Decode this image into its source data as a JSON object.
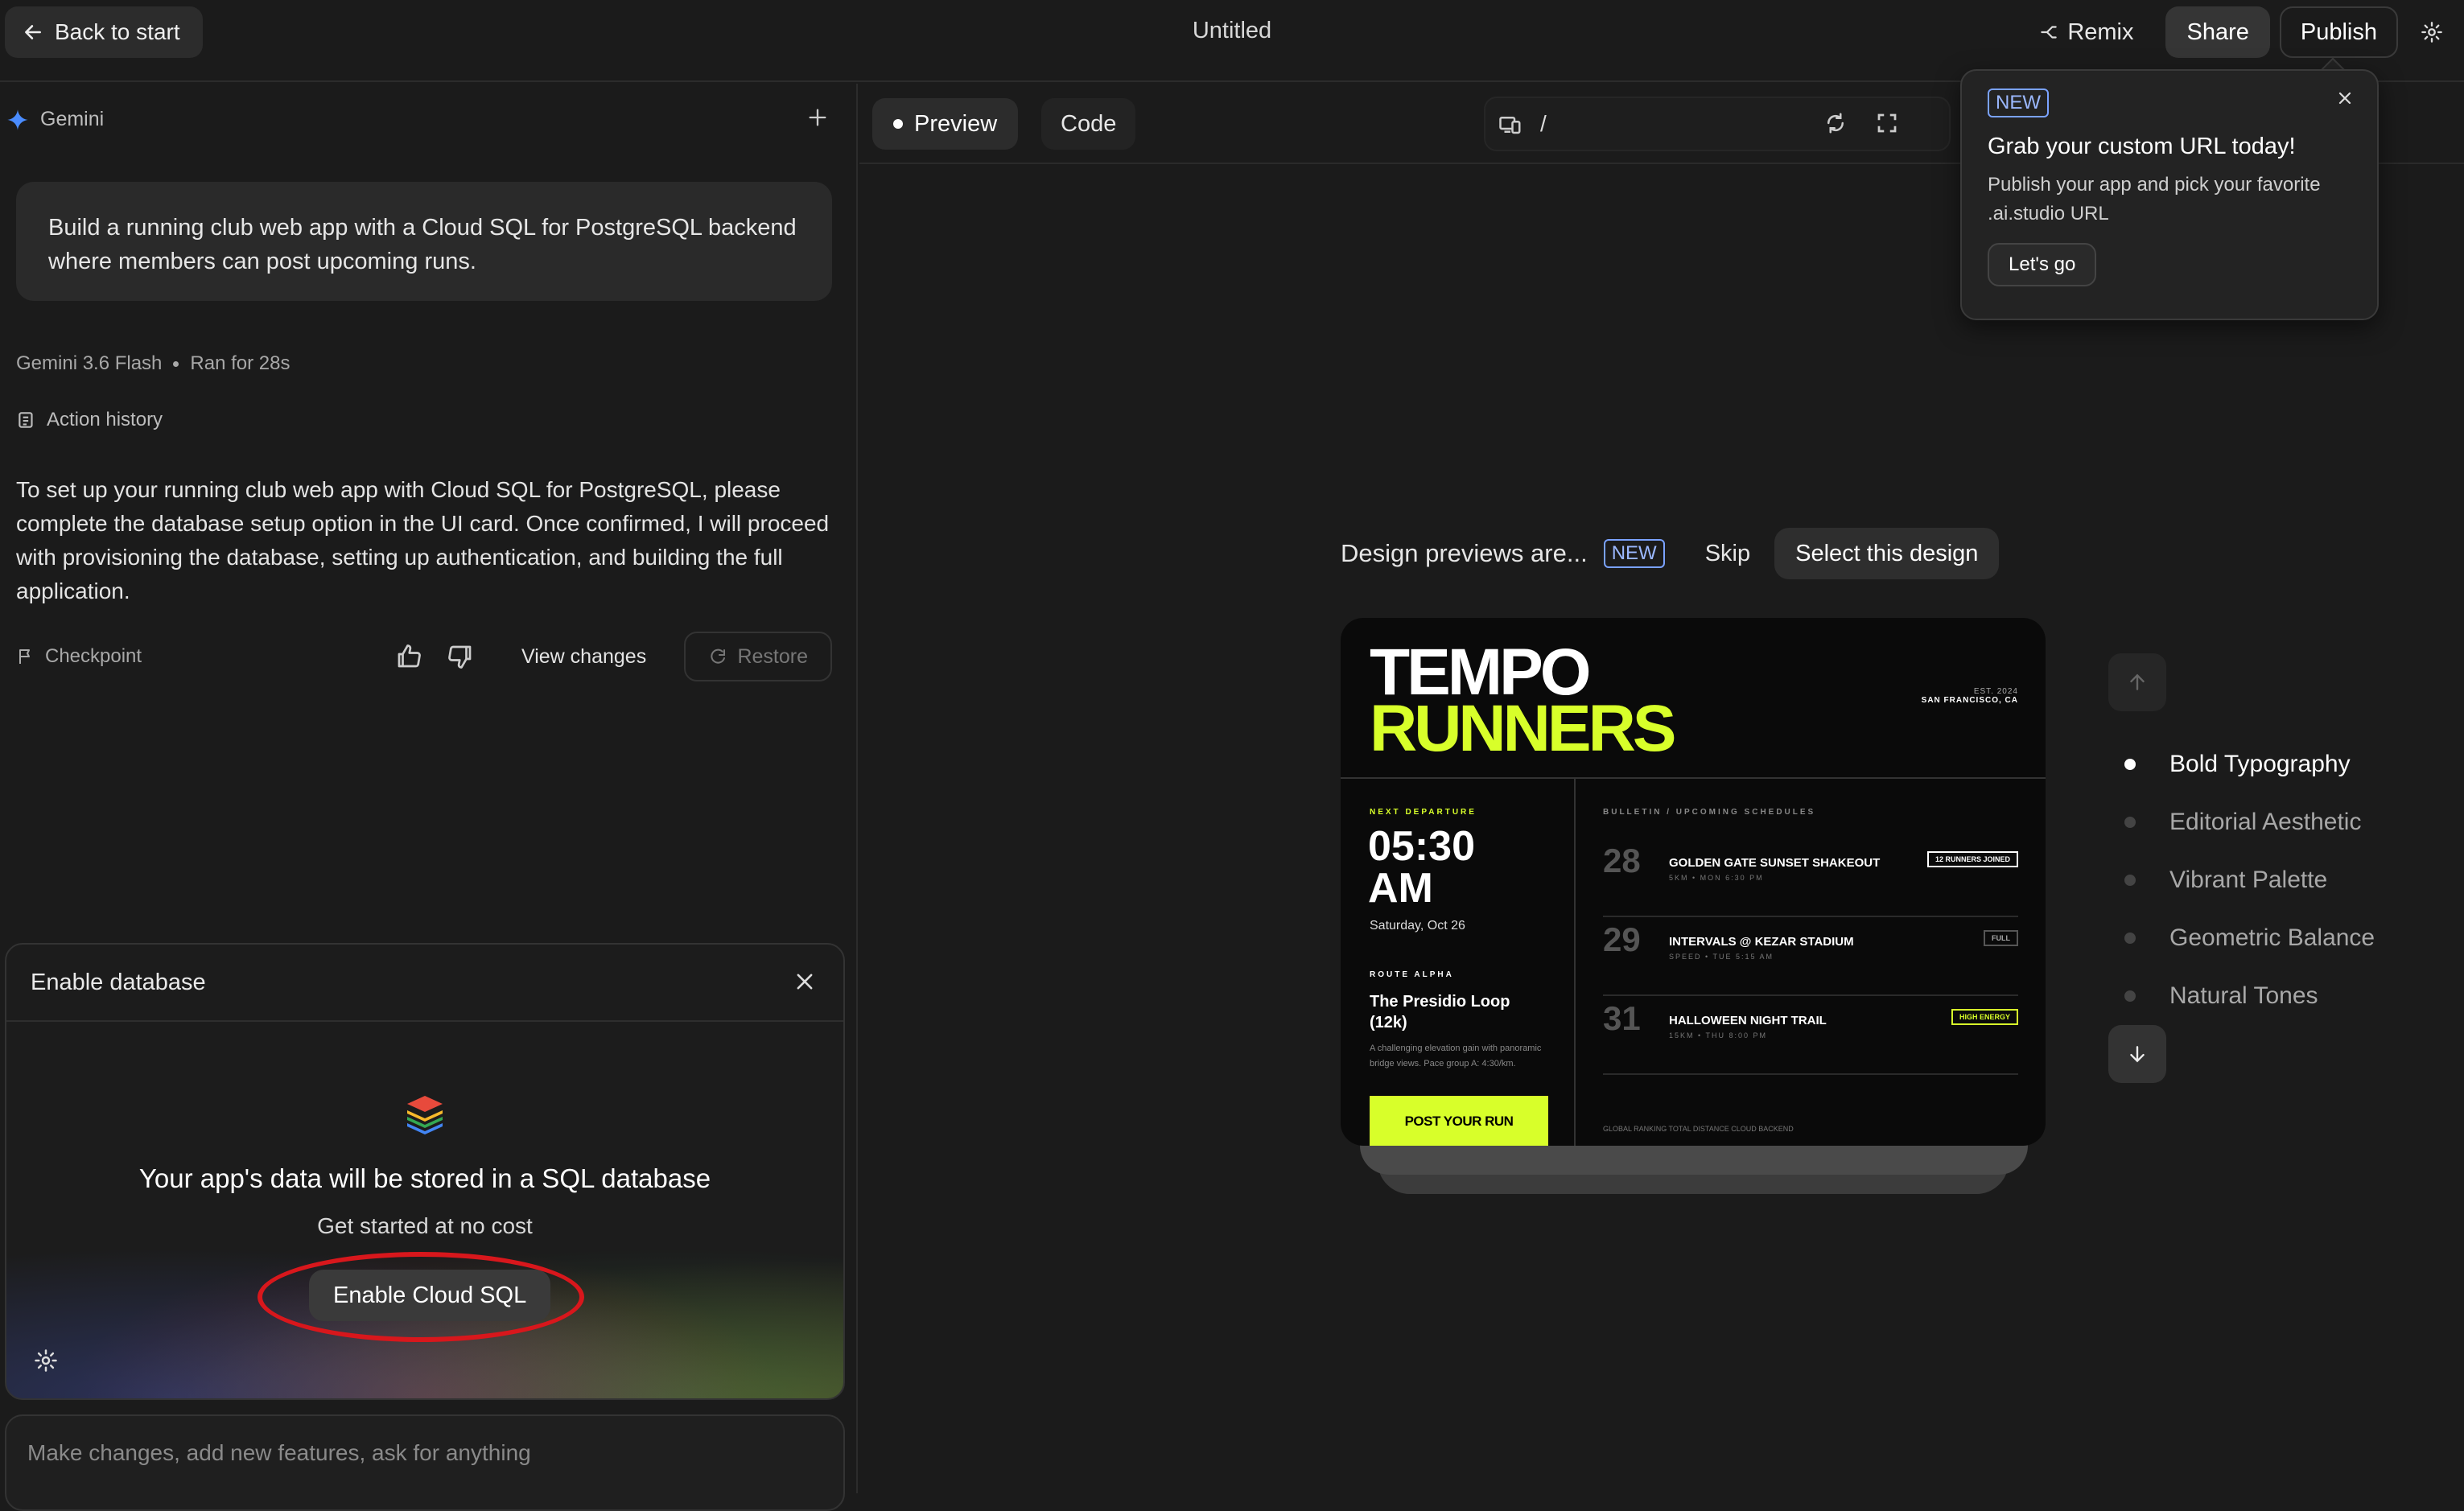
{
  "topbar": {
    "back_label": "Back to start",
    "title": "Untitled",
    "remix_label": "Remix",
    "share_label": "Share",
    "publish_label": "Publish"
  },
  "chat": {
    "model_name": "Gemini",
    "prompt": "Build a running club web app with a Cloud SQL for PostgreSQL backend where members can post upcoming runs.",
    "model_version": "Gemini 3.6 Flash",
    "run_time": "Ran for 28s",
    "action_history": "Action history",
    "reply": "To set up your running club web app with Cloud SQL for PostgreSQL, please complete the database setup option in the UI card. Once confirmed, I will proceed with provisioning the database, setting up authentication, and building the full application.",
    "checkpoint": "Checkpoint",
    "view_changes": "View changes",
    "restore": "Restore"
  },
  "db_card": {
    "header": "Enable database",
    "title": "Your app's data will be stored in a SQL database",
    "subtitle": "Get started at no cost",
    "button": "Enable Cloud SQL"
  },
  "input": {
    "placeholder": "Make changes, add new features, ask for anything"
  },
  "toolbar": {
    "preview_tab": "Preview",
    "code_tab": "Code",
    "url_path": "/"
  },
  "popover": {
    "badge": "NEW",
    "title": "Grab your custom URL today!",
    "body": "Publish your app and pick your favorite .ai.studio URL",
    "button": "Let's go"
  },
  "design_preview": {
    "label": "Design previews are...",
    "badge": "NEW",
    "skip": "Skip",
    "select": "Select this design",
    "styles": [
      "Bold Typography",
      "Editorial Aesthetic",
      "Vibrant Palette",
      "Geometric Balance",
      "Natural Tones"
    ],
    "active_style": "Bold Typography"
  },
  "mock": {
    "brand_line1": "TEMPO",
    "brand_line2": "RUNNERS",
    "est": "EST. 2024",
    "city": "SAN FRANCISCO, CA",
    "next_departure": "NEXT DEPARTURE",
    "time": "05:30 AM",
    "date": "Saturday, Oct 26",
    "route_label": "ROUTE ALPHA",
    "route_name": "The Presidio Loop (12k)",
    "route_desc": "A challenging elevation gain with panoramic bridge views. Pace group A: 4:30/km.",
    "post_button": "POST YOUR RUN",
    "bulletin": "BULLETIN / UPCOMING SCHEDULES",
    "runs": [
      {
        "num": "28",
        "name": "GOLDEN GATE SUNSET SHAKEOUT",
        "sub": "5KM • MON 6:30 PM",
        "tag": "12 RUNNERS JOINED"
      },
      {
        "num": "29",
        "name": "INTERVALS @ KEZAR STADIUM",
        "sub": "SPEED • TUE 5:15 AM",
        "tag": "FULL"
      },
      {
        "num": "31",
        "name": "HALLOWEEN NIGHT TRAIL",
        "sub": "15KM • THU 8:00 PM",
        "tag": "HIGH ENERGY"
      }
    ],
    "footer": "GLOBAL RANKING    TOTAL DISTANCE    CLOUD BACKEND"
  }
}
